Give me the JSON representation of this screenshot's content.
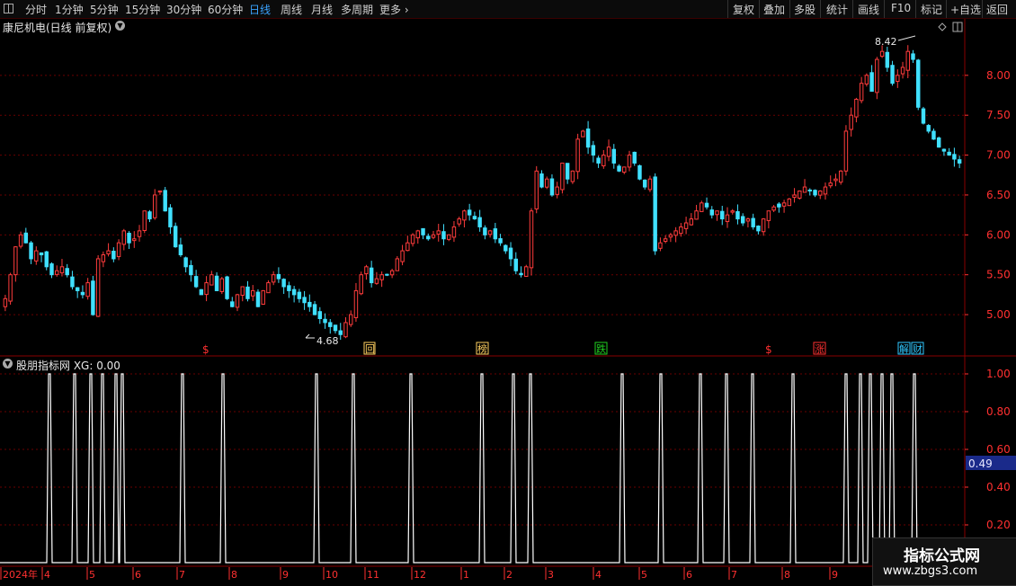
{
  "toolbar": {
    "left_items": [
      "分时",
      "1分钟",
      "5分钟",
      "15分钟",
      "30分钟",
      "60分钟",
      "日线",
      "周线",
      "月线",
      "多周期",
      "更多"
    ],
    "active": "日线",
    "right_items": [
      "复权",
      "叠加",
      "多股",
      "统计",
      "画线",
      "F10",
      "标记",
      "+自选",
      "返回"
    ]
  },
  "main_chart": {
    "title": "康尼机电(日线 前复权)",
    "high_label": "8.42",
    "low_label": "4.68",
    "y_ticks": [
      "8.00",
      "7.50",
      "7.00",
      "6.50",
      "6.00",
      "5.50",
      "5.00"
    ],
    "markers": [
      {
        "text": "$",
        "color": "#ff3030",
        "boxed": false
      },
      {
        "text": "回",
        "color": "#ffd060",
        "boxed": true
      },
      {
        "text": "榜",
        "color": "#ffd060",
        "boxed": true
      },
      {
        "text": "跌",
        "color": "#20d020",
        "boxed": true
      },
      {
        "text": "$",
        "color": "#ff3030",
        "boxed": false
      },
      {
        "text": "涨",
        "color": "#ff3030",
        "boxed": true
      },
      {
        "text": "解",
        "color": "#30c8ff",
        "boxed": true
      },
      {
        "text": "财",
        "color": "#30c8ff",
        "boxed": true
      }
    ]
  },
  "indicator": {
    "title": "股朋指标网 XG: 0.00",
    "y_ticks": [
      "1.00",
      "0.80",
      "0.60",
      "0.40",
      "0.20"
    ],
    "current_value": "0.49"
  },
  "date_axis": {
    "labels": [
      "2024年",
      "4",
      "5",
      "6",
      "7",
      "8",
      "9",
      "10",
      "11",
      "12",
      "1",
      "2",
      "3",
      "4",
      "5",
      "6",
      "7",
      "8",
      "9"
    ]
  },
  "watermark": {
    "line1": "指标公式网",
    "line2": "www.zbgs3.com"
  },
  "colors": {
    "up": "#ff3c3c",
    "down": "#40e0ff",
    "grid": "#6a0000",
    "axis": "#ff3030"
  },
  "chart_data": {
    "type": "candlestick",
    "title": "康尼机电(日线 前复权)",
    "ylim": [
      4.55,
      8.55
    ],
    "close": [
      5.2,
      5.5,
      5.85,
      6.0,
      5.9,
      5.7,
      5.8,
      5.75,
      5.6,
      5.5,
      5.55,
      5.6,
      5.5,
      5.35,
      5.3,
      5.25,
      5.4,
      5.0,
      5.7,
      5.75,
      5.8,
      5.7,
      5.9,
      6.05,
      5.9,
      5.95,
      6.05,
      6.3,
      6.2,
      6.5,
      6.55,
      6.3,
      6.1,
      5.85,
      5.75,
      5.6,
      5.5,
      5.35,
      5.25,
      5.4,
      5.5,
      5.3,
      5.45,
      5.2,
      5.1,
      5.25,
      5.35,
      5.2,
      5.3,
      5.1,
      5.3,
      5.4,
      5.5,
      5.45,
      5.35,
      5.3,
      5.25,
      5.2,
      5.15,
      5.1,
      5.0,
      4.95,
      4.9,
      4.85,
      4.8,
      4.75,
      4.9,
      5.0,
      5.3,
      5.5,
      5.6,
      5.4,
      5.45,
      5.5,
      5.5,
      5.55,
      5.7,
      5.8,
      5.9,
      6.0,
      6.05,
      6.0,
      5.95,
      6.0,
      6.05,
      5.95,
      6.0,
      6.1,
      6.2,
      6.3,
      6.25,
      6.2,
      6.1,
      6.0,
      6.05,
      5.95,
      5.9,
      5.8,
      5.7,
      5.55,
      5.5,
      5.6,
      6.3,
      6.8,
      6.6,
      6.7,
      6.5,
      6.6,
      6.9,
      6.7,
      6.8,
      7.2,
      7.3,
      7.1,
      7.0,
      6.9,
      7.0,
      7.1,
      6.9,
      6.8,
      6.85,
      7.0,
      6.9,
      6.7,
      6.6,
      6.7,
      5.8,
      5.9,
      5.95,
      6.0,
      6.05,
      6.1,
      6.15,
      6.2,
      6.3,
      6.4,
      6.35,
      6.25,
      6.3,
      6.2,
      6.25,
      6.3,
      6.2,
      6.15,
      6.2,
      6.1,
      6.05,
      6.2,
      6.3,
      6.35,
      6.35,
      6.4,
      6.45,
      6.5,
      6.55,
      6.6,
      6.55,
      6.5,
      6.55,
      6.6,
      6.65,
      6.7,
      6.8,
      7.3,
      7.5,
      7.7,
      7.9,
      8.0,
      7.8,
      8.2,
      8.3,
      8.1,
      7.9,
      8.0,
      8.1,
      8.3,
      8.2,
      7.6,
      7.4,
      7.3,
      7.2,
      7.1,
      7.05,
      7.0,
      6.95,
      6.9
    ]
  }
}
